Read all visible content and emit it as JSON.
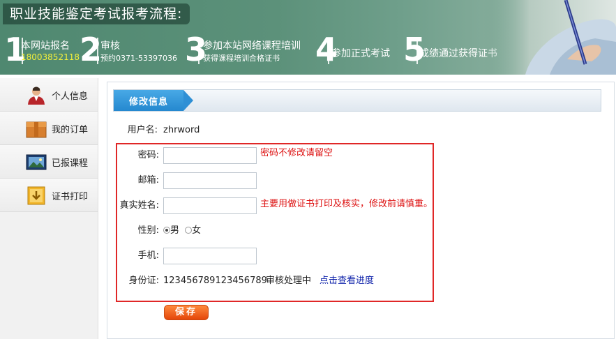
{
  "banner": {
    "title": "职业技能鉴定考试报考流程:",
    "steps": [
      {
        "num": "1",
        "main": "本网站报名",
        "sub": "18003852118"
      },
      {
        "num": "2",
        "main": "审核",
        "sub": "预约0371-53397036"
      },
      {
        "num": "3",
        "main": "参加本站网络课程培训",
        "sub": "获得课程培训合格证书"
      },
      {
        "num": "4",
        "main": "参加正式考试",
        "sub": ""
      },
      {
        "num": "5",
        "main": "成绩通过获得证书",
        "sub": ""
      }
    ]
  },
  "sidebar": {
    "items": [
      {
        "label": "个人信息",
        "icon": "user-icon"
      },
      {
        "label": "我的订单",
        "icon": "package-icon"
      },
      {
        "label": "已报课程",
        "icon": "course-icon"
      },
      {
        "label": "证书打印",
        "icon": "download-icon"
      }
    ]
  },
  "main": {
    "tab_label": "修改信息",
    "username_label": "用户名:",
    "username_value": "zhrword",
    "password_label": "密码:",
    "password_value": "",
    "password_hint": "密码不修改请留空",
    "email_label": "邮箱:",
    "email_value": "",
    "realname_label": "真实姓名:",
    "realname_value": "",
    "realname_hint": "主要用做证书打印及核实，修改前请慎重。",
    "gender_label": "性别:",
    "gender_male": "男",
    "gender_female": "女",
    "gender_selected": "男",
    "phone_label": "手机:",
    "phone_value": "",
    "idcard_label": "身份证:",
    "idcard_value": "123456789123456789",
    "review_status": "审核处理中",
    "progress_link": "点击查看进度",
    "save_label": "保存"
  },
  "colors": {
    "banner_green": "#5c917a",
    "tab_blue": "#2e8fd5",
    "hint_red": "#dd1111",
    "link_blue": "#0a1ea8",
    "highlight_box": "#e02727",
    "save_orange": "#e4460a"
  }
}
